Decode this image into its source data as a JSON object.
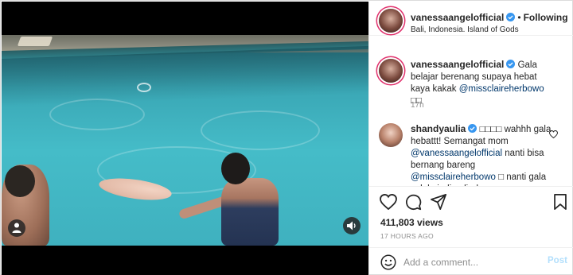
{
  "header": {
    "username": "vanessaangelofficial",
    "separator": "•",
    "follow_label": "Following",
    "location": "Bali, Indonesia. Island of Gods"
  },
  "caption": {
    "username": "vanessaangelofficial",
    "text": "Gala belajar berenang supaya hebat kaya kakak",
    "mention": "@missclaireherbowo",
    "emoji": "□□",
    "time": "17h"
  },
  "comments": [
    {
      "username": "shandyaulia",
      "emoji": "□□□□",
      "text1": "wahhh gala hebattt! Semangat mom",
      "mention1": "@vanessaangelofficial",
      "text2": "nanti bisa bernang bareng",
      "mention2": "@missclaireherbowo",
      "text3": "□ nanti gala selalu jadi pelindung mommy"
    }
  ],
  "stats": {
    "views": "411,803 views",
    "time_ago": "17 HOURS AGO"
  },
  "add_comment": {
    "placeholder": "Add a comment...",
    "post_label": "Post"
  },
  "colors": {
    "verified": "#3897f0",
    "story_ring": "#e1306c",
    "link": "#00376b",
    "post_disabled": "#b2dffc",
    "muted": "#8e8e8e"
  },
  "icons": [
    "user-tag-icon",
    "mute-icon",
    "verified-badge-icon",
    "heart-icon",
    "comment-icon",
    "share-icon",
    "bookmark-icon",
    "emoji-icon"
  ]
}
